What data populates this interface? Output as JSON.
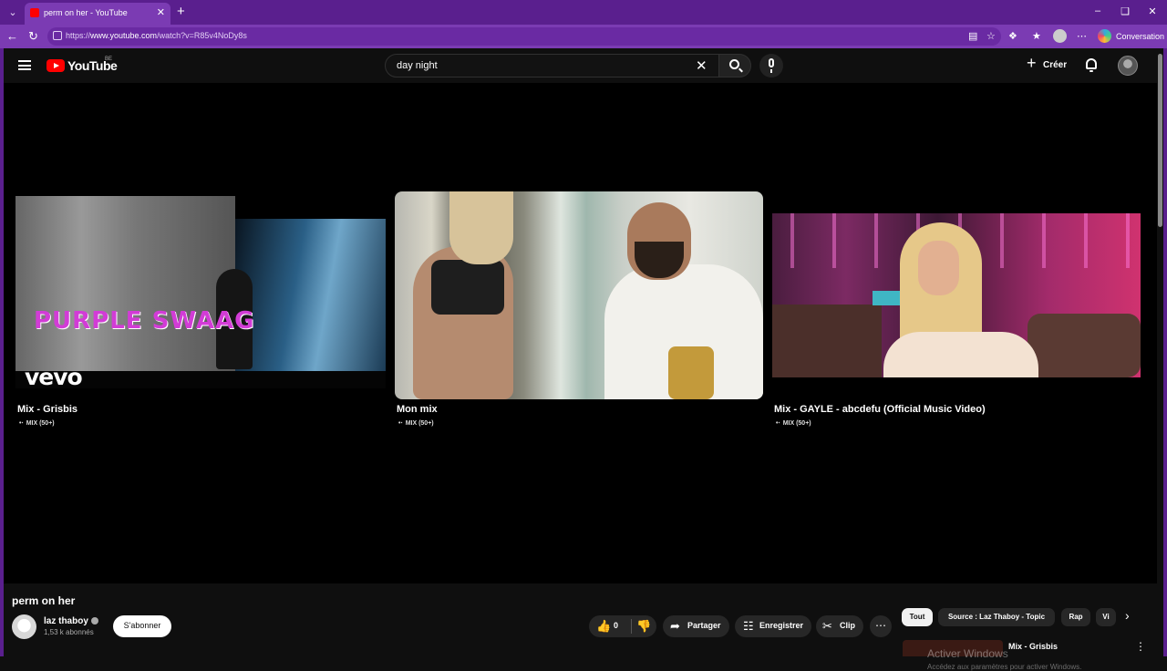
{
  "browser": {
    "tab_title": "perm on her - YouTube",
    "url_prefix": "https://",
    "url_host": "www.youtube.com",
    "url_path": "/watch?v=R85v4NoDy8s",
    "conversation_label": "Conversation"
  },
  "header": {
    "logo_text": "YouTube",
    "region_badge": "BE",
    "search_value": "day night",
    "create_label": "Créer"
  },
  "end_screen": [
    {
      "title": "Mix - Grisbis",
      "meta": "MIX (50+)",
      "overlay_text": "PURPLE SWAAG",
      "brand": "vevo"
    },
    {
      "title": "Mon mix",
      "meta": "MIX (50+)"
    },
    {
      "title": "Mix - GAYLE - abcdefu (Official Music Video)",
      "meta": "MIX (50+)"
    }
  ],
  "video": {
    "title": "perm on her",
    "channel_name": "laz thaboy",
    "subscribers": "1,53 k abonnés",
    "subscribe_label": "S'abonner",
    "like_count": "0",
    "share_label": "Partager",
    "save_label": "Enregistrer",
    "clip_label": "Clip"
  },
  "chips": [
    "Tout",
    "Source : Laz Thaboy - Topic",
    "Rap",
    "Vi"
  ],
  "related": {
    "title": "Mix - Grisbis"
  },
  "watermark": {
    "line1": "Activer Windows",
    "line2": "Accédez aux paramètres pour activer Windows."
  },
  "colors": {
    "brand_red": "#ff0000",
    "browser_frame": "#5a1f8e",
    "page_bg": "#0f0f0f"
  }
}
